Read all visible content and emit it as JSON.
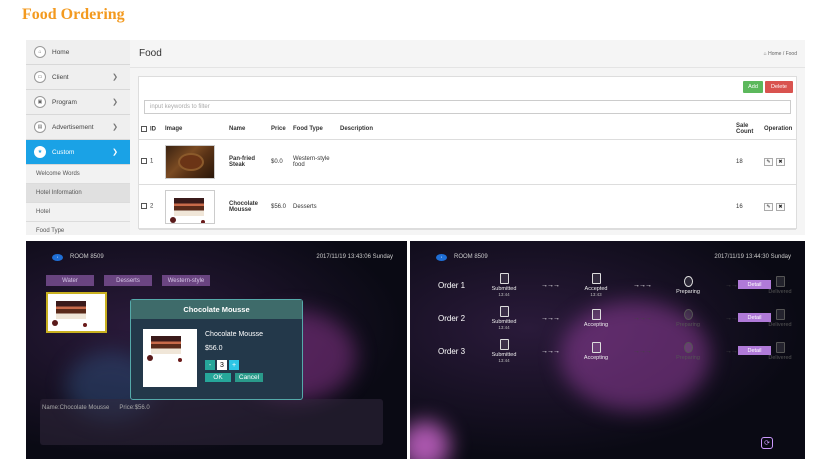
{
  "page_title": "Food Ordering",
  "admin": {
    "sidebar": {
      "items": [
        {
          "label": "Home",
          "icon": "home-icon"
        },
        {
          "label": "Client",
          "icon": "monitor-icon"
        },
        {
          "label": "Program",
          "icon": "film-icon"
        },
        {
          "label": "Advertisement",
          "icon": "image-icon"
        },
        {
          "label": "Custom",
          "icon": "star-icon"
        }
      ],
      "sub_items": [
        "Welcome Words",
        "Hotel Information",
        "Hotel",
        "Food Type"
      ]
    },
    "header": {
      "title": "Food",
      "breadcrumb": "Home / Food"
    },
    "toolbar": {
      "add_label": "Add",
      "delete_label": "Delete"
    },
    "search": {
      "placeholder": "input keywords to filter"
    },
    "table": {
      "columns": [
        "ID",
        "Image",
        "Name",
        "Price",
        "Food Type",
        "Description",
        "Sale Count",
        "Operation"
      ],
      "rows": [
        {
          "id": "1",
          "name": "Pan-fried Steak",
          "price": "$0.0",
          "food_type": "Western-style food",
          "description": "",
          "sale_count": "18"
        },
        {
          "id": "2",
          "name": "Chocolate Mousse",
          "price": "$56.0",
          "food_type": "Desserts",
          "description": "",
          "sale_count": "16"
        }
      ]
    }
  },
  "tv_menu": {
    "room": "ROOM 8509",
    "clock": "2017/11/19 13:43:06 Sunday",
    "tabs": [
      "Water",
      "Desserts",
      "Western-style"
    ],
    "modal": {
      "title": "Chocolate Mousse",
      "name": "Chocolate Mousse",
      "price": "$56.0",
      "minus": "-",
      "quantity": "3",
      "plus": "+",
      "ok": "OK",
      "cancel": "Cancel"
    },
    "info": {
      "name": "Name:Chocolate Mousse",
      "price": "Price:$56.0"
    }
  },
  "tv_orders": {
    "room": "ROOM 8509",
    "clock": "2017/11/19 13:44:30 Sunday",
    "detail_label": "Detail",
    "orders": [
      {
        "label": "Order 1",
        "stages": [
          {
            "name": "Submitted",
            "time": "13:44"
          },
          {
            "name": "Accepted",
            "time": "13:43"
          },
          {
            "name": "Preparing",
            "time": ""
          },
          {
            "name": "Delivered",
            "time": ""
          }
        ]
      },
      {
        "label": "Order 2",
        "stages": [
          {
            "name": "Submitted",
            "time": "13:44"
          },
          {
            "name": "Accepting",
            "time": ""
          },
          {
            "name": "Preparing",
            "time": ""
          },
          {
            "name": "Delivered",
            "time": ""
          }
        ]
      },
      {
        "label": "Order 3",
        "stages": [
          {
            "name": "Submitted",
            "time": "13:44"
          },
          {
            "name": "Accepting",
            "time": ""
          },
          {
            "name": "Preparing",
            "time": ""
          },
          {
            "name": "Delivered",
            "time": ""
          }
        ]
      }
    ]
  },
  "colors": {
    "title_orange": "#f39a1f",
    "active_blue": "#1aa2e6",
    "add_green": "#5cb85c",
    "delete_red": "#d9534f",
    "detail_purple": "#b07ad8"
  }
}
